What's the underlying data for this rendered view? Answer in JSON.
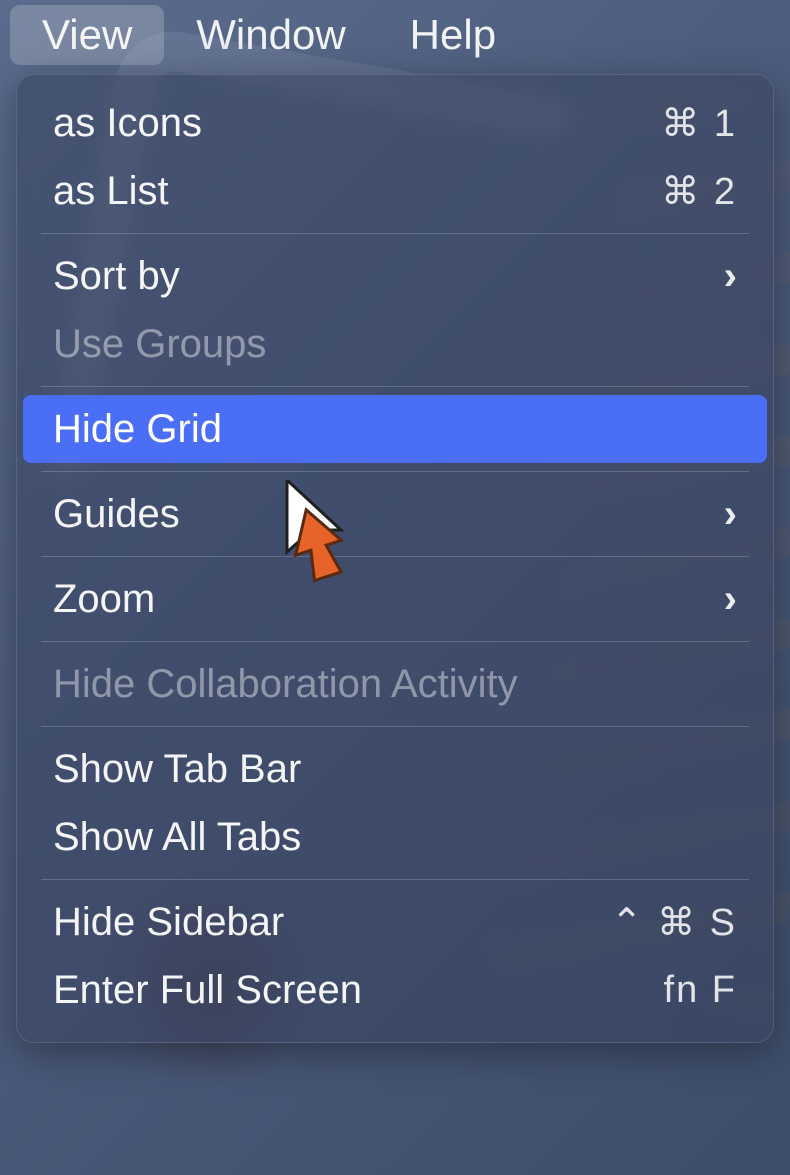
{
  "menubar": {
    "view": "View",
    "window": "Window",
    "help": "Help"
  },
  "menu": {
    "as_icons": {
      "label": "as Icons",
      "shortcut": "⌘ 1"
    },
    "as_list": {
      "label": "as List",
      "shortcut": "⌘ 2"
    },
    "sort_by": {
      "label": "Sort by"
    },
    "use_groups": {
      "label": "Use Groups"
    },
    "hide_grid": {
      "label": "Hide Grid"
    },
    "guides": {
      "label": "Guides"
    },
    "zoom": {
      "label": "Zoom"
    },
    "hide_collab": {
      "label": "Hide Collaboration Activity"
    },
    "show_tab_bar": {
      "label": "Show Tab Bar"
    },
    "show_all_tabs": {
      "label": "Show All Tabs"
    },
    "hide_sidebar": {
      "label": "Hide Sidebar",
      "shortcut": "⌃ ⌘ S"
    },
    "enter_full_screen": {
      "label": "Enter Full Screen",
      "shortcut": "fn F"
    }
  }
}
